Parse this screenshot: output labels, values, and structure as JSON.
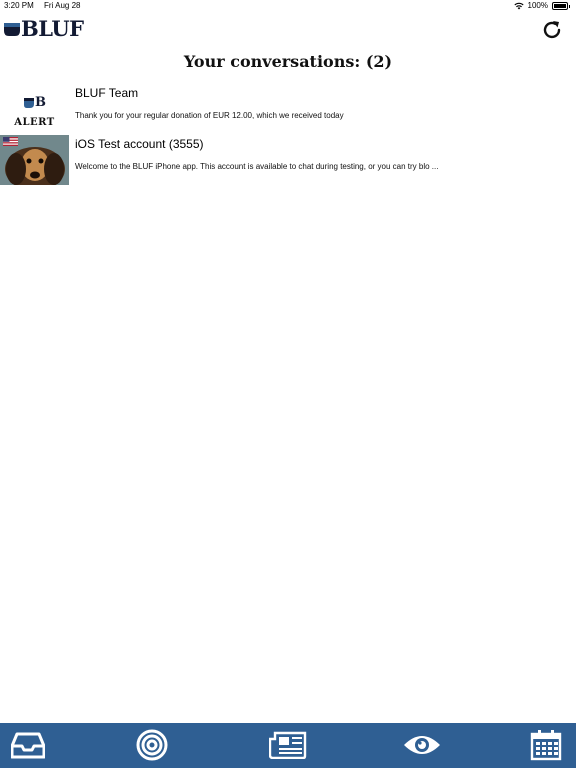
{
  "status_bar": {
    "time": "3:20 PM",
    "date": "Fri Aug 28",
    "battery": "100%"
  },
  "header": {
    "logo_text": "BLUF"
  },
  "page": {
    "title": "Your conversations: (2)"
  },
  "conversations": [
    {
      "name": "BLUF Team",
      "preview": "Thank you for your regular donation of EUR 12.00, which we received today",
      "avatar_label": "ALERT",
      "avatar_logo": "B"
    },
    {
      "name": "iOS Test account (3555)",
      "preview": "Welcome to the BLUF iPhone app. This account is available to chat during testing, or you can try blo ..."
    }
  ],
  "tabs": [
    {
      "icon": "inbox-icon"
    },
    {
      "icon": "target-icon"
    },
    {
      "icon": "newspaper-icon"
    },
    {
      "icon": "eye-icon"
    },
    {
      "icon": "calendar-icon"
    }
  ],
  "colors": {
    "tab_bar": "#2f5f93",
    "logo": "#121a33",
    "accent_blue": "#2f5f93"
  }
}
